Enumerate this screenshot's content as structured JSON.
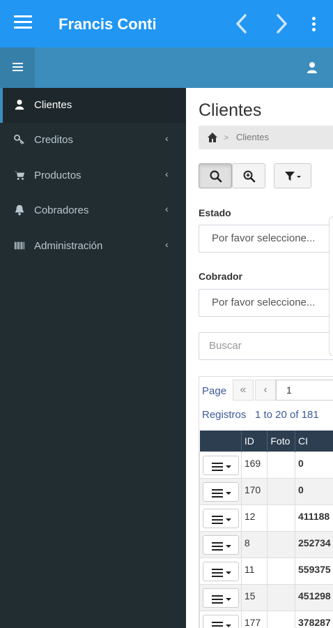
{
  "appbar": {
    "title": "Francis Conti"
  },
  "sidebar": {
    "items": [
      {
        "label": "Clientes",
        "icon": "user-icon",
        "active": true
      },
      {
        "label": "Creditos",
        "icon": "key-icon"
      },
      {
        "label": "Productos",
        "icon": "cart-icon"
      },
      {
        "label": "Cobradores",
        "icon": "bell-icon"
      },
      {
        "label": "Administración",
        "icon": "barcode-icon"
      }
    ]
  },
  "main": {
    "title": "Clientes",
    "breadcrumb": {
      "separator": ">",
      "current": "Clientes"
    },
    "filters": {
      "estado_label": "Estado",
      "estado_value": "Por favor seleccione...",
      "cobrador_label": "Cobrador",
      "cobrador_value": "Por favor seleccione...",
      "search_placeholder": "Buscar"
    },
    "pager": {
      "page_label": "Page",
      "first": "«",
      "prev": "‹",
      "page_value": "1",
      "records_label": "Registros",
      "records_range": "1 to 20 of 181"
    },
    "table": {
      "columns": [
        "",
        "ID",
        "Foto",
        "CI"
      ],
      "rows": [
        {
          "id": "169",
          "foto": "",
          "ci": "0"
        },
        {
          "id": "170",
          "foto": "",
          "ci": "0"
        },
        {
          "id": "12",
          "foto": "",
          "ci": "411188"
        },
        {
          "id": "8",
          "foto": "",
          "ci": "252734"
        },
        {
          "id": "11",
          "foto": "",
          "ci": "559375"
        },
        {
          "id": "15",
          "foto": "",
          "ci": "451298"
        },
        {
          "id": "177",
          "foto": "",
          "ci": "378287"
        }
      ]
    }
  },
  "colors": {
    "appbar": "#2196f3",
    "subbar": "#3c8dbc",
    "sidebar": "#222d32",
    "table_header": "#2c3e50"
  }
}
